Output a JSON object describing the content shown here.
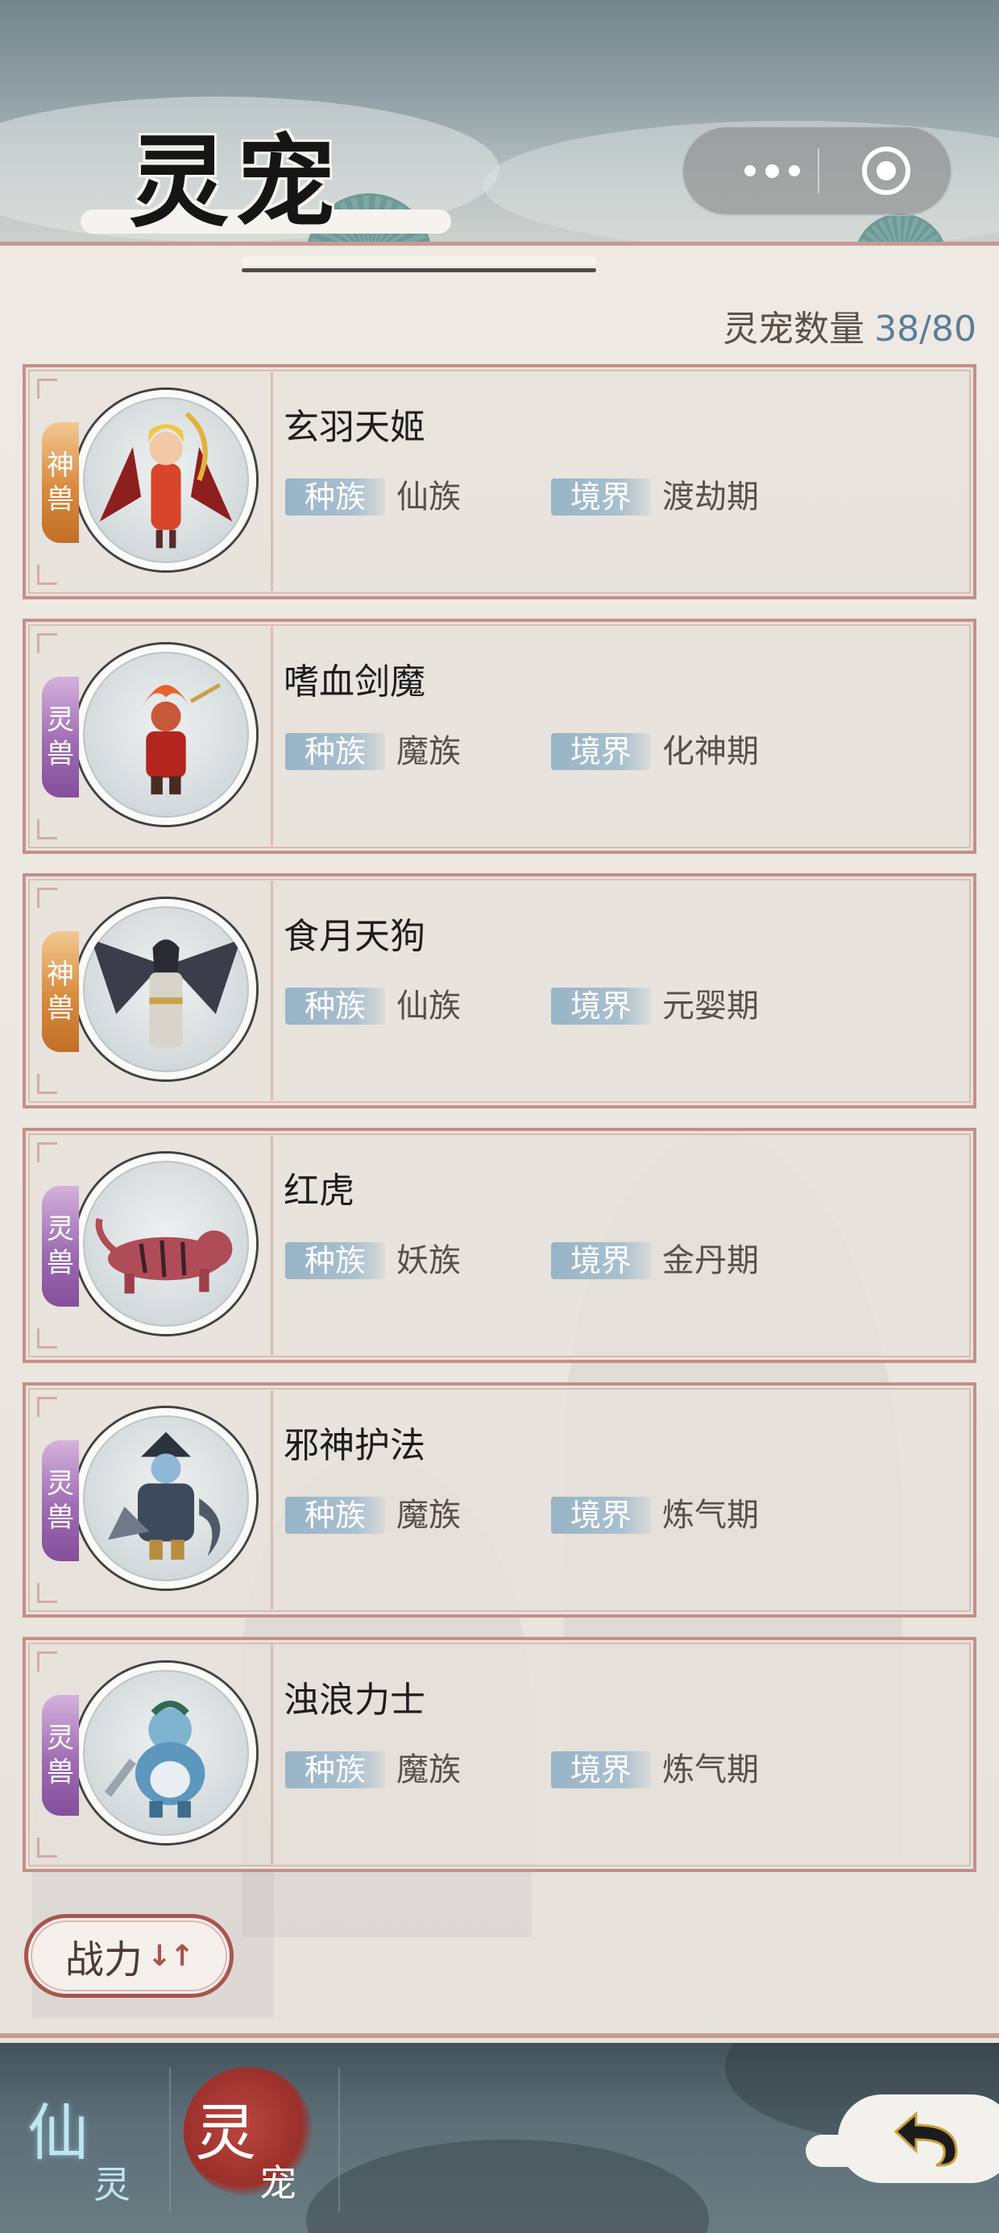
{
  "header": {
    "title": "灵宠"
  },
  "pet_count": {
    "label": "灵宠数量",
    "value": "38/80"
  },
  "field_labels": {
    "race": "种族",
    "realm": "境界"
  },
  "pets": [
    {
      "name": "玄羽天姬",
      "tag_top": "神",
      "tag_bottom": "兽",
      "tag_type": "divine",
      "race": "仙族",
      "realm": "渡劫期",
      "tag_color": "#d88a3e"
    },
    {
      "name": "嗜血剑魔",
      "tag_top": "灵",
      "tag_bottom": "兽",
      "tag_type": "spirit",
      "race": "魔族",
      "realm": "化神期",
      "tag_color": "#9e6cb1"
    },
    {
      "name": "食月天狗",
      "tag_top": "神",
      "tag_bottom": "兽",
      "tag_type": "divine",
      "race": "仙族",
      "realm": "元婴期",
      "tag_color": "#d88a3e"
    },
    {
      "name": "红虎",
      "tag_top": "灵",
      "tag_bottom": "兽",
      "tag_type": "spirit",
      "race": "妖族",
      "realm": "金丹期",
      "tag_color": "#9e6cb1"
    },
    {
      "name": "邪神护法",
      "tag_top": "灵",
      "tag_bottom": "兽",
      "tag_type": "spirit",
      "race": "魔族",
      "realm": "炼气期",
      "tag_color": "#9e6cb1"
    },
    {
      "name": "浊浪力士",
      "tag_top": "灵",
      "tag_bottom": "兽",
      "tag_type": "spirit",
      "race": "魔族",
      "realm": "炼气期",
      "tag_color": "#9e6cb1"
    }
  ],
  "sort_button": {
    "label": "战力",
    "arrows": "↓↑"
  },
  "bottom_nav": {
    "tabs": [
      {
        "big": "仙",
        "small": "灵",
        "active": false
      },
      {
        "big": "灵",
        "small": "宠",
        "active": true
      }
    ],
    "back_icon": "back-arrow-icon"
  },
  "capsule": {
    "more_icon": "more-dots-icon",
    "close_icon": "target-circle-icon"
  },
  "colors": {
    "accent_red": "#a8554f",
    "card_border": "#c49088",
    "chip_blue": "#98b3c6",
    "count_blue": "#5a7e99"
  }
}
